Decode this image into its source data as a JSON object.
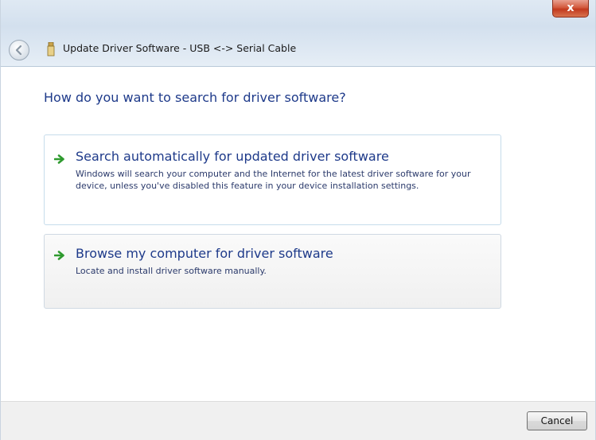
{
  "window": {
    "title": "Update Driver Software - USB <-> Serial Cable",
    "close_symbol": "x",
    "close_icon": "close-icon",
    "back_icon": "back-arrow-icon",
    "device_icon": "usb-device-icon"
  },
  "main": {
    "heading": "How do you want to search for driver software?",
    "options": [
      {
        "title": "Search automatically for updated driver software",
        "description": "Windows will search your computer and the Internet for the latest driver software for your device, unless you've disabled this feature in your device installation settings.",
        "icon": "green-arrow-icon"
      },
      {
        "title": "Browse my computer for driver software",
        "description": "Locate and install driver software manually.",
        "icon": "green-arrow-icon"
      }
    ]
  },
  "footer": {
    "cancel_label": "Cancel"
  },
  "colors": {
    "link_blue": "#1e3a8a",
    "arrow_green": "#2e9a2e",
    "close_red": "#c2391e"
  }
}
